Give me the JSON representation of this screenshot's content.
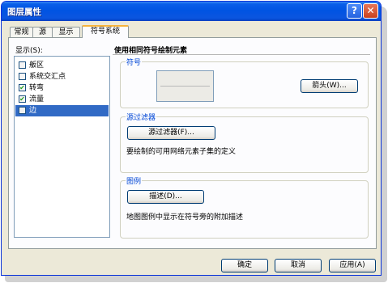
{
  "window": {
    "title": "图层属性",
    "help_glyph": "?",
    "close_glyph": "✕"
  },
  "tabs": [
    "常规",
    "源",
    "显示",
    "符号系统"
  ],
  "display": {
    "label": "显示(S):",
    "items": [
      {
        "label": "舨区",
        "checked": false,
        "selected": false
      },
      {
        "label": "系统交汇点",
        "checked": false,
        "selected": false
      },
      {
        "label": "转弯",
        "checked": true,
        "selected": false
      },
      {
        "label": "流量",
        "checked": true,
        "selected": false
      },
      {
        "label": "边",
        "checked": false,
        "selected": true
      }
    ]
  },
  "headline": "使用相同符号绘制元素",
  "symbol_group": {
    "title": "符号",
    "button": "箭头(W)..."
  },
  "filter_group": {
    "title": "源过滤器",
    "button": "源过滤器(F)...",
    "description": "要绘制的可用网络元素子集的定义"
  },
  "legend_group": {
    "title": "图例",
    "button": "描述(D)...",
    "description": "地图图例中显示在符号旁的附加描述"
  },
  "footer": {
    "ok": "确定",
    "cancel": "取消",
    "apply": "应用(A)"
  }
}
